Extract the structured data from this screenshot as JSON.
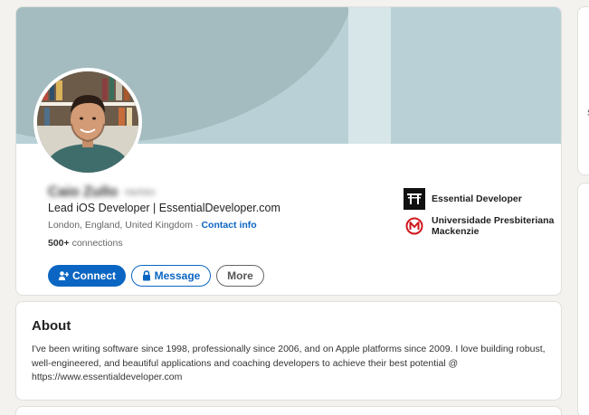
{
  "profile": {
    "name": "Caio Zullo",
    "pronouns": "He/Him",
    "headline": "Lead iOS Developer | EssentialDeveloper.com",
    "location": "London, England, United Kingdom",
    "separator": "·",
    "contact_info": "Contact info",
    "connections_count": "500+",
    "connections_label": "connections"
  },
  "actions": {
    "connect": "Connect",
    "message": "Message",
    "more": "More"
  },
  "organizations": [
    {
      "name": "Essential Developer",
      "icon": "essential-developer-logo"
    },
    {
      "name": "Universidade Presbiteriana Mackenzie",
      "icon": "mackenzie-logo"
    }
  ],
  "about": {
    "title": "About",
    "text": "I've been writing software since 1998, professionally since 2006, and on Apple platforms since 2009. I love building robust, well-engineered, and beautiful applications and coaching developers to achieve their best potential @ https://www.essentialdeveloper.com"
  },
  "sidebar": {
    "glyph": "S"
  },
  "colors": {
    "banner": "#b9d1d6",
    "banner_arc": "#a4bcbf",
    "primary": "#0a66c2",
    "page_bg": "#f4f2ee"
  }
}
